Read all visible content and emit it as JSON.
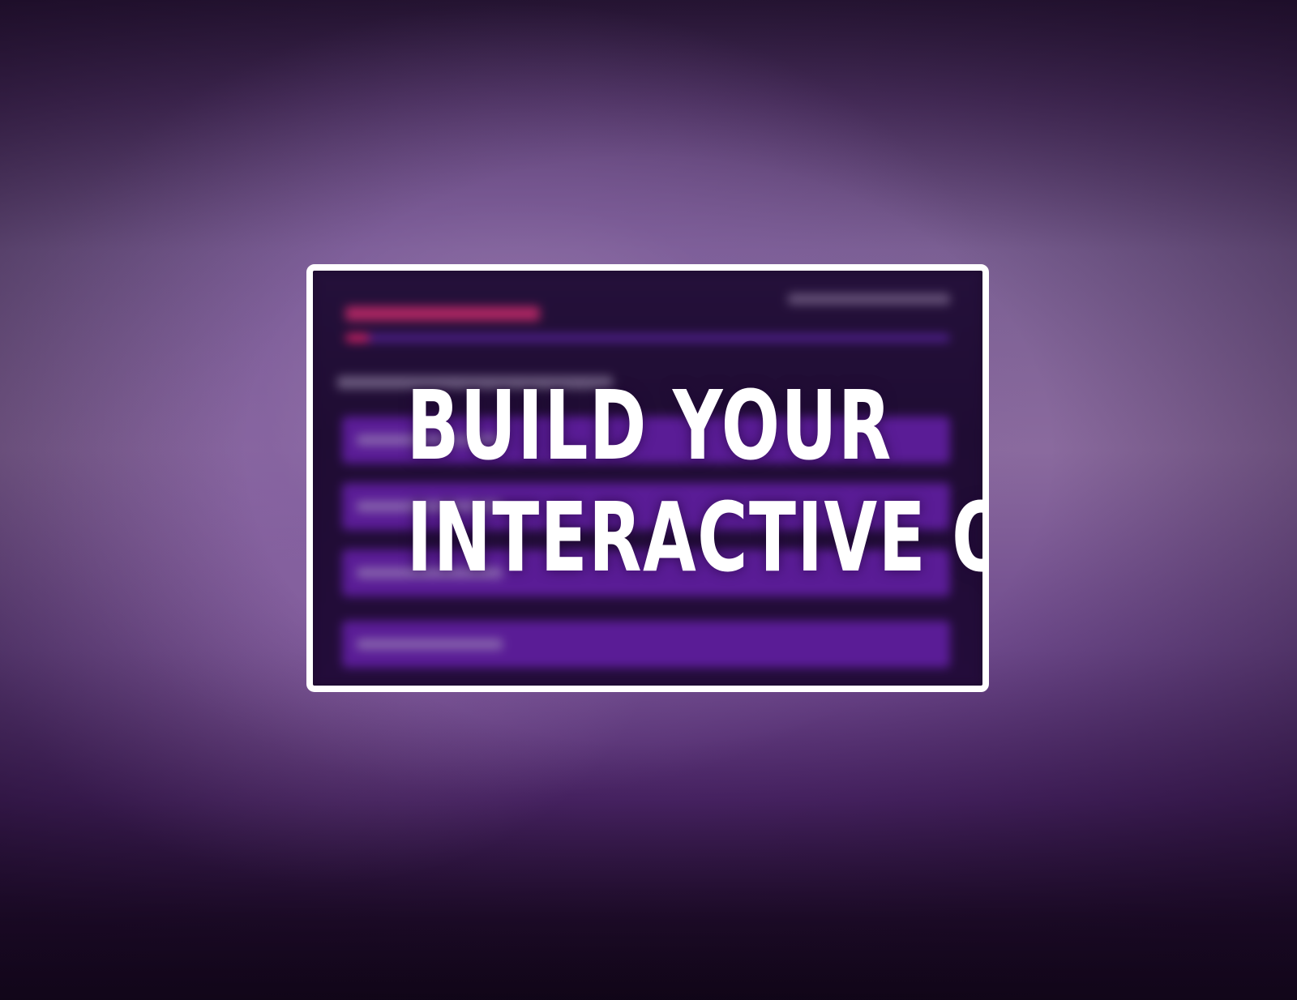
{
  "headline": {
    "line1": "BUILD YOUR",
    "line2": "INTERACTIVE QUIZ"
  },
  "colors": {
    "background_top": "#2a1838",
    "background_mid": "#8a6a9e",
    "background_bottom": "#0e0513",
    "card_border": "#ffffff",
    "card_fill": "#1e0b2e",
    "option_fill": "#5a1c96",
    "accent": "#d02266",
    "headline_text": "#ffffff"
  }
}
